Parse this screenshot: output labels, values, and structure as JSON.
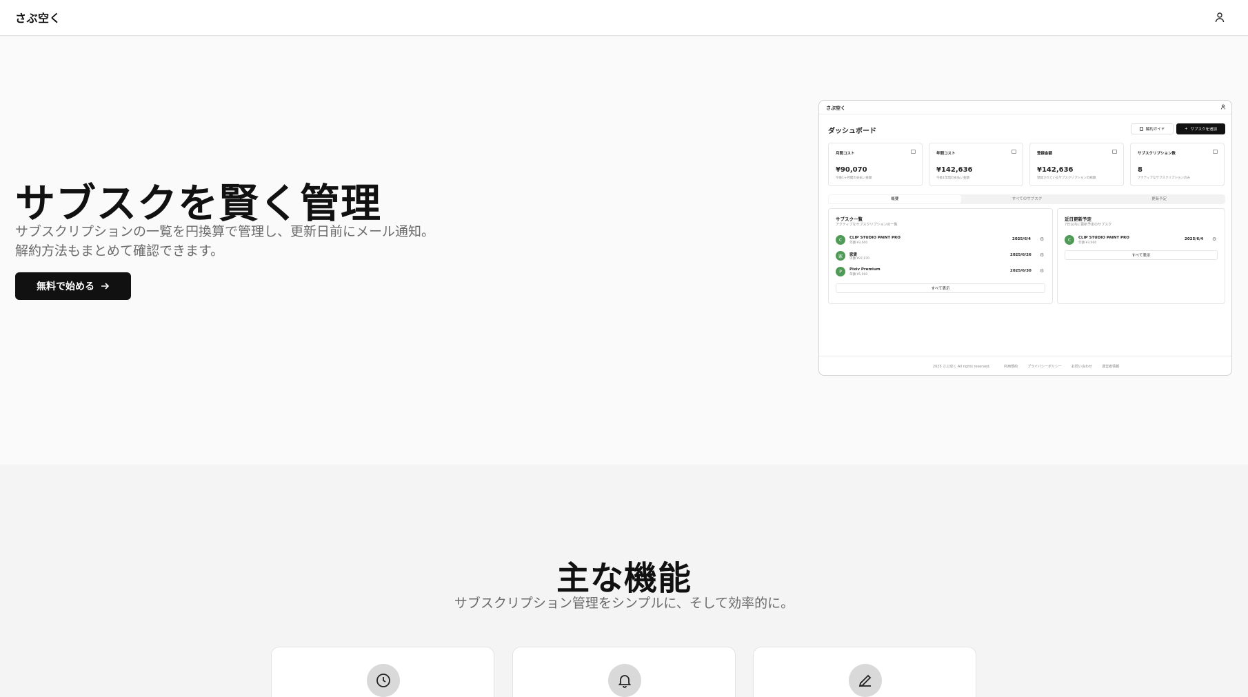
{
  "app": {
    "brand": "さぶ空く"
  },
  "hero": {
    "title": "サブスクを賢く管理",
    "description": "サブスクリプションの一覧を円換算で管理し、更新日前にメール通知。解約方法もまとめて確認できます。",
    "cta_label": "無料で始める"
  },
  "preview": {
    "brand": "さぶ空く",
    "title": "ダッシュボード",
    "guide_label": "解約ガイド",
    "add_label": "サブスクを追加",
    "stats": [
      {
        "label": "月間コスト",
        "value": "¥90,070",
        "sub": "今後1ヶ月間の支払い金額"
      },
      {
        "label": "年間コスト",
        "value": "¥142,636",
        "sub": "今後1年間の支払い金額"
      },
      {
        "label": "登録金額",
        "value": "¥142,636",
        "sub": "登録されているサブスクリプションの総額"
      },
      {
        "label": "サブスクリプション数",
        "value": "8",
        "sub": "アクティブなサブスクリプションのみ"
      }
    ],
    "tabs": [
      "概要",
      "すべてのサブスク",
      "更新予定"
    ],
    "list_panel": {
      "title": "サブスク一覧",
      "subtitle": "アクティブなサブスクリプションの一覧",
      "items": [
        {
          "initial": "C",
          "name": "CLIP STUDIO PAINT PRO",
          "price": "年額 ¥3,000",
          "date": "2025/6/4"
        },
        {
          "initial": "家",
          "name": "家賃",
          "price": "年額 ¥97,070",
          "date": "2025/6/26"
        },
        {
          "initial": "P",
          "name": "Pixiv Premium",
          "price": "年額 ¥5,000",
          "date": "2025/6/30"
        }
      ],
      "show_all": "すべて表示"
    },
    "upcoming_panel": {
      "title": "近日更新予定",
      "subtitle": "7日以内に更新予定のサブスク",
      "items": [
        {
          "initial": "C",
          "name": "CLIP STUDIO PAINT PRO",
          "price": "年額 ¥3,000",
          "date": "2025/6/4"
        }
      ],
      "show_all": "すべて表示"
    },
    "footer": {
      "copyright": "2025 さぶ空く All rights reserved.",
      "links": [
        "利用規約",
        "プライバシーポリシー",
        "お問い合わせ",
        "運営者情報"
      ]
    }
  },
  "features": {
    "title": "主な機能",
    "subtitle": "サブスクリプション管理をシンプルに、そして効率的に。",
    "cards": [
      {
        "icon": "clock-icon"
      },
      {
        "icon": "bell-icon"
      },
      {
        "icon": "pencil-icon"
      }
    ]
  }
}
